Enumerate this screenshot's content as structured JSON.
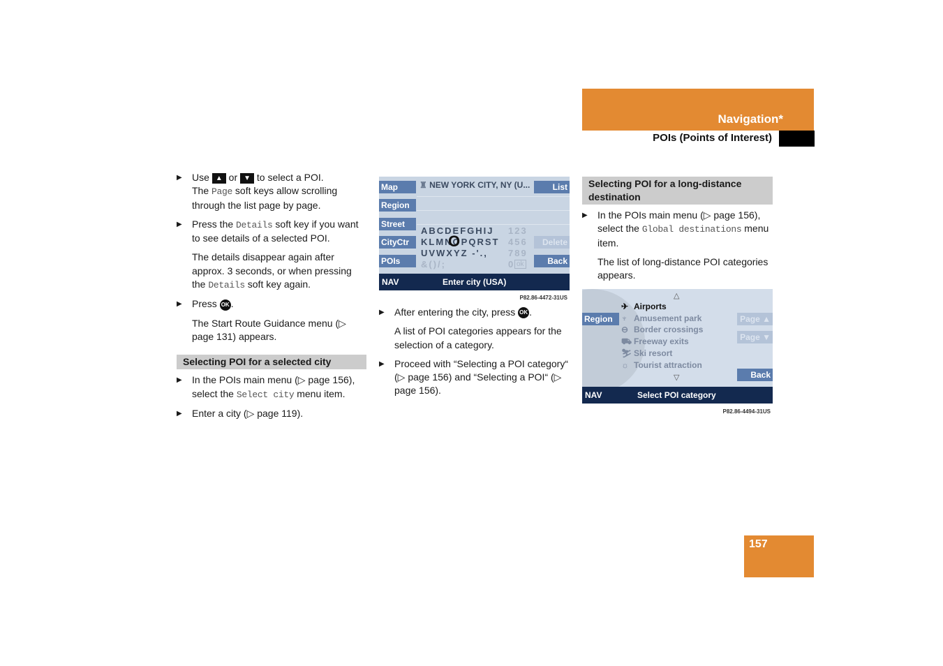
{
  "header": {
    "section": "Navigation*",
    "subsection": "POIs (Points of Interest)"
  },
  "page_number": "157",
  "colors": {
    "accent": "#e38a32",
    "section_bg": "#cccccc",
    "screen_nav": "#13294f",
    "screen_button": "#5b7cad"
  },
  "left_column": {
    "b1": {
      "pre": "Use ",
      "up_key": "▲",
      "mid": " or ",
      "down_key": "▼",
      "post": " to select a POI."
    },
    "b1_line2_pre": "The ",
    "b1_line2_mono": "Page",
    "b1_line2_post": " soft keys allow scrolling through the list page by page.",
    "b2_pre": "Press the ",
    "b2_mono": "Details",
    "b2_post": " soft key if you want to see details of a selected POI.",
    "p1_pre": "The details disappear again after approx. 3 seconds, or when pressing the ",
    "p1_mono": "Details",
    "p1_post": " soft key again.",
    "b3_pre": "Press ",
    "b3_ok": "OK",
    "b3_post": ".",
    "p2": "The Start Route Guidance menu (▷ page 131) appears.",
    "section_title": "Selecting POI for a selected city",
    "b4_pre": "In the POIs main menu (▷ page 156), select the ",
    "b4_mono": "Select city",
    "b4_post": " menu item.",
    "b5": "Enter a city (▷ page 119)."
  },
  "middle_column": {
    "screen1": {
      "left_buttons": [
        "Map",
        "Region",
        "Street",
        "CityCtr",
        "POIs"
      ],
      "title": "NEW YORK CITY, NY (U...",
      "right_buttons": {
        "list": "List",
        "delete": "Delete",
        "back": "Back"
      },
      "keyboard_rows": [
        "ABCDEFGHIJ",
        "KLMNOPQRST",
        "UVWXYZ -'.,",
        "&()/;"
      ],
      "number_rows": [
        "123",
        "456",
        "789",
        "0"
      ],
      "ok_key": "ok",
      "cursor_letter": "O",
      "nav_label": "NAV",
      "nav_prompt": "Enter city (USA)",
      "caption": "P82.86-4472-31US"
    },
    "b1_pre": "After entering the city, press ",
    "b1_ok": "OK",
    "b1_post": ".",
    "p1": "A list of POI categories appears for the selection of a category.",
    "b2": "Proceed with “Selecting a POI category“ (▷ page 156) and “Selecting a POI“ (▷ page 156)."
  },
  "right_column": {
    "section_title": "Selecting POI for a long-distance destination",
    "b1_pre": "In the POIs main menu (▷ page 156), select the ",
    "b1_mono": "Global destinations",
    "b1_post": " menu item.",
    "p1": "The list of long-distance POI categories appears.",
    "screen2": {
      "left_button": "Region",
      "page_up": "Page ▲",
      "page_down": "Page ▼",
      "back": "Back",
      "scroll_up": "△",
      "scroll_down": "▽",
      "items": [
        {
          "icon": "✈",
          "label": "Airports",
          "selected": true
        },
        {
          "icon": "♆",
          "label": "Amusement park",
          "selected": false
        },
        {
          "icon": "⊖",
          "label": "Border crossings",
          "selected": false
        },
        {
          "icon": "⛟",
          "label": "Freeway exits",
          "selected": false
        },
        {
          "icon": "⛷",
          "label": "Ski resort",
          "selected": false
        },
        {
          "icon": "☼",
          "label": "Tourist attraction",
          "selected": false
        }
      ],
      "nav_label": "NAV",
      "nav_prompt": "Select POI category",
      "caption": "P82.86-4494-31US"
    }
  }
}
